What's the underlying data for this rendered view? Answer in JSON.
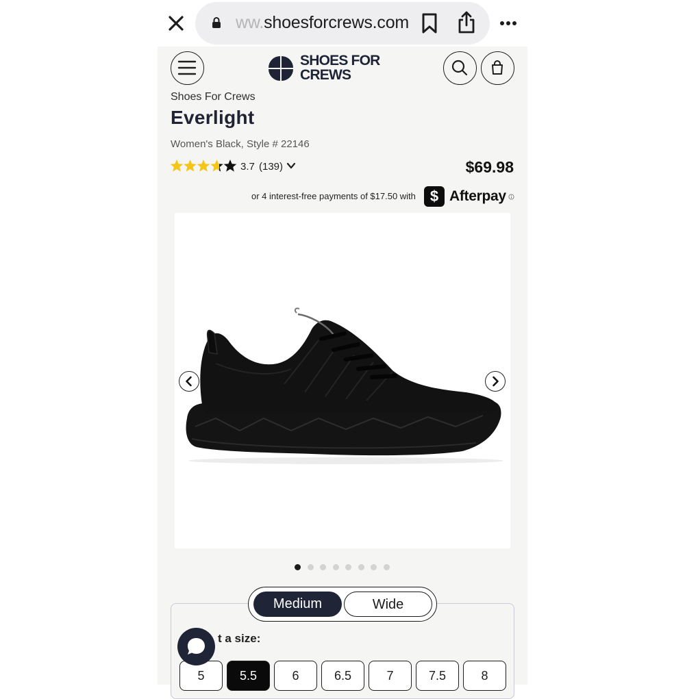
{
  "browser": {
    "url_prefix": "ww.",
    "url_domain": "shoesforcrews.com"
  },
  "header": {
    "logo_line1": "SHOES FOR",
    "logo_line2": "CREWS"
  },
  "product": {
    "brand": "Shoes For Crews",
    "name": "Everlight",
    "variant": "Women's Black, Style # 22146",
    "rating": "3.7",
    "rating_value": 3.7,
    "rating_max": 5,
    "review_count": "(139)",
    "price": "$69.98"
  },
  "afterpay": {
    "text": "or 4 interest-free payments of $17.50 with",
    "badge_glyph": "$",
    "name": "Afterpay"
  },
  "gallery": {
    "image_count": 8,
    "active_index": 0
  },
  "width_options": {
    "medium": "Medium",
    "wide": "Wide",
    "selected": "Medium"
  },
  "size_section": {
    "label_visible": "t a size:",
    "sizes": [
      "5",
      "5.5",
      "6",
      "6.5",
      "7",
      "7.5",
      "8"
    ],
    "selected": "5.5"
  },
  "colors": {
    "navy": "#1f2436",
    "star": "#f5c518",
    "page_bg": "#f5f6f3"
  },
  "icons": [
    "close-icon",
    "lock-icon",
    "bookmark-icon",
    "share-icon",
    "more-icon",
    "menu-icon",
    "search-icon",
    "bag-icon",
    "chevron-down-icon",
    "info-icon",
    "chevron-left-icon",
    "chevron-right-icon",
    "chat-icon"
  ]
}
